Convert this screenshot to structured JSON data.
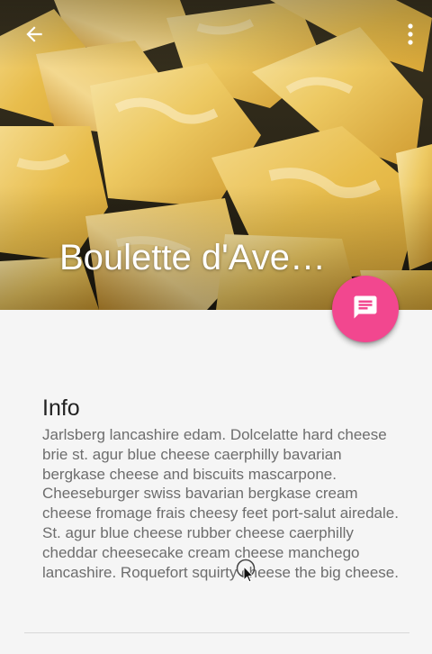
{
  "app_bar": {
    "back_icon": "arrow-back-icon",
    "overflow_icon": "more-vert-icon",
    "title": "Boulette d'Ave…"
  },
  "header_image": {
    "subject": "marbled cheese cubes"
  },
  "fab": {
    "icon": "chat-bubble-icon",
    "color": "#f2478f"
  },
  "info": {
    "heading": "Info",
    "body": "Jarlsberg lancashire edam. Dolcelatte hard cheese brie st. agur blue cheese caerphilly bavarian bergkase cheese and biscuits mascarpone. Cheeseburger swiss bavarian bergkase cream cheese fromage frais cheesy feet port-salut airedale. St. agur blue cheese rubber cheese caerphilly cheddar cheesecake cream cheese manchego lancashire. Roquefort squirty cheese the big cheese."
  },
  "colors": {
    "background": "#f5f5f5",
    "accent": "#f2478f",
    "heading_text": "#222222",
    "body_text": "#6d6d6d"
  }
}
